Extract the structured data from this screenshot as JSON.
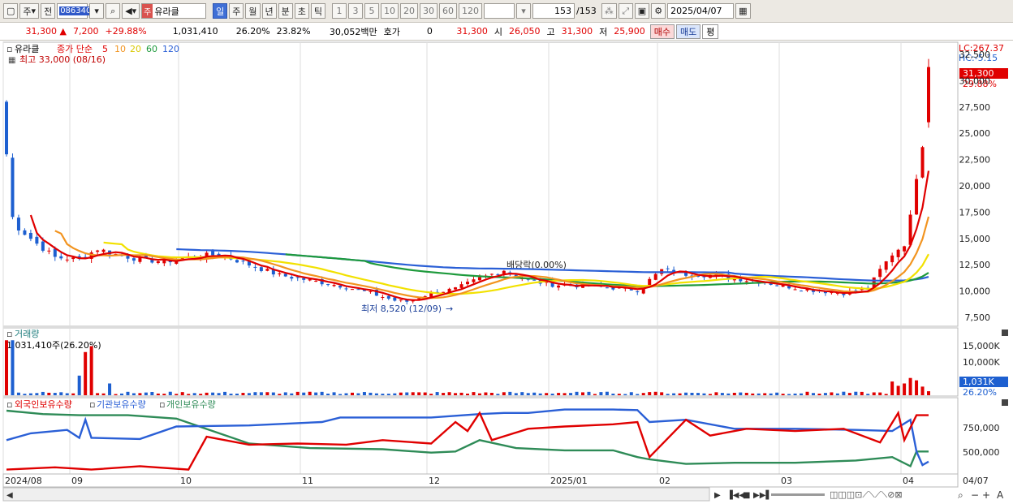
{
  "toolbar": {
    "market": "주",
    "prev": "전",
    "code": "086340",
    "name_tag": "주",
    "name": "유라클",
    "periods": [
      "일",
      "주",
      "월",
      "년",
      "분",
      "초",
      "틱"
    ],
    "active_period": "일",
    "intervals": [
      "1",
      "3",
      "5",
      "10",
      "20",
      "30",
      "60",
      "120"
    ],
    "count": "153",
    "total": "/153",
    "date": "2025/04/07"
  },
  "quote": {
    "price": "31,300",
    "change": "7,200",
    "change_pct": "+29.88%",
    "volume": "1,031,410",
    "turnover_pct": "26.20%",
    "ratio_pct": "23.82%",
    "amount": "30,052백만",
    "hoga_label": "호가",
    "hoga_value": "0",
    "hoga_price": "31,300",
    "open_label": "시",
    "open": "26,050",
    "high_label": "고",
    "high": "31,300",
    "low_label": "저",
    "low": "25,900",
    "buy_label": "매수",
    "sell_label": "매도",
    "eval_label": "평"
  },
  "main_panel": {
    "name": "유라클",
    "legend_prefix": "종가 단순",
    "ma_labels": [
      "5",
      "10",
      "20",
      "60",
      "120"
    ],
    "high_note": "최고 33,000 (08/16)",
    "low_note": "최저 8,520 (12/09)",
    "dividend_note": "배당락(0.00%)",
    "lc": "LC:267.37",
    "hc": "HC:-5.15",
    "last_price": "31,300",
    "last_pct": "29.88%",
    "y_ticks": [
      "32,500",
      "30,000",
      "27,500",
      "25,000",
      "22,500",
      "20,000",
      "17,500",
      "15,000",
      "12,500",
      "10,000",
      "7,500"
    ]
  },
  "volume_panel": {
    "title": "거래량",
    "note": "1,031,410주(26.20%)",
    "y_ticks": [
      "15,000K",
      "10,000K"
    ],
    "last_value": "1,031K",
    "last_pct": "26.20%"
  },
  "holding_panel": {
    "legend": [
      "외국인보유수량",
      "기관보유수량",
      "개인보유수량"
    ],
    "y_ticks": [
      "750,000",
      "500,000"
    ]
  },
  "x_axis": {
    "labels": [
      "2024/08",
      "09",
      "10",
      "11",
      "12",
      "2025/01",
      "02",
      "03",
      "04"
    ],
    "end_label": "04/07"
  },
  "colors": {
    "up": "#e00000",
    "down": "#1d5fd0",
    "ma5": "#e00000",
    "ma10": "#f29420",
    "ma20": "#f2e100",
    "ma60": "#1e9a3c",
    "ma120": "#2a5fd6",
    "foreign": "#e00000",
    "institution": "#2a5fd6",
    "individual": "#2e8b57"
  }
}
